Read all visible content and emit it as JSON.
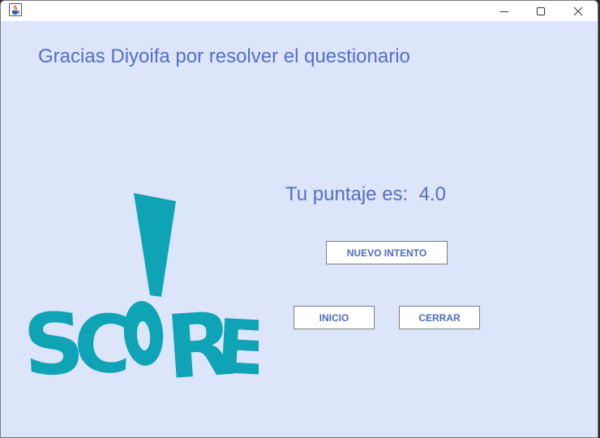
{
  "window": {
    "icon": "java-cup-icon",
    "controls": [
      "minimize-icon",
      "maximize-icon",
      "close-icon"
    ]
  },
  "main": {
    "heading": "Gracias Diyoifa por resolver el questionario",
    "score_label": "Tu puntaje es:",
    "score_value": "4.0",
    "buttons": {
      "retry": "NUEVO INTENTO",
      "home": "INICIO",
      "close": "CERRAR"
    },
    "art_text": "SCORE",
    "art_icon": "exclamation-score-logo"
  },
  "colors": {
    "background": "#dde5fb",
    "text_accent": "#5470c4",
    "art_teal": "#0ea3b5"
  }
}
